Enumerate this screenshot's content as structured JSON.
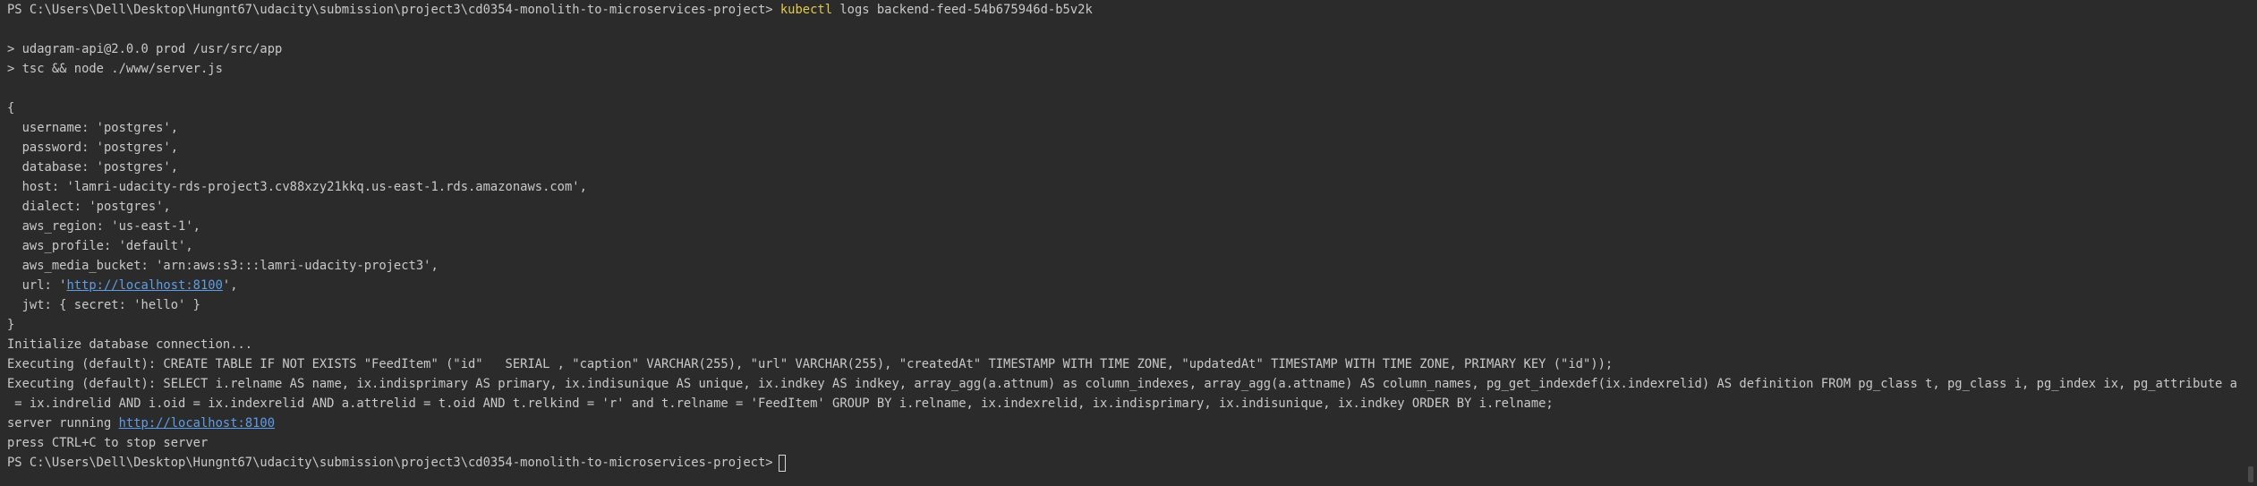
{
  "terminal": {
    "prompt1": "PS C:\\Users\\Dell\\Desktop\\Hungnt67\\udacity\\submission\\project3\\cd0354-monolith-to-microservices-project>",
    "cmd_word": "kubectl",
    "cmd_rest": "logs backend-feed-54b675946d-b5v2k",
    "npm1": "> udagram-api@2.0.0 prod /usr/src/app",
    "npm2": "> tsc && node ./www/server.js",
    "brace_open": "{",
    "cfg_username": "  username: 'postgres',",
    "cfg_password": "  password: 'postgres',",
    "cfg_database": "  database: 'postgres',",
    "cfg_host": "  host: 'lamri-udacity-rds-project3.cv88xzy21kkq.us-east-1.rds.amazonaws.com',",
    "cfg_dialect": "  dialect: 'postgres',",
    "cfg_region": "  aws_region: 'us-east-1',",
    "cfg_profile": "  aws_profile: 'default',",
    "cfg_bucket": "  aws_media_bucket: 'arn:aws:s3:::lamri-udacity-project3',",
    "cfg_url_prefix": "  url: '",
    "cfg_url_link": "http://localhost:8100",
    "cfg_url_suffix": "',",
    "cfg_jwt": "  jwt: { secret: 'hello' }",
    "brace_close": "}",
    "init": "Initialize database connection...",
    "exec1": "Executing (default): CREATE TABLE IF NOT EXISTS \"FeedItem\" (\"id\"   SERIAL , \"caption\" VARCHAR(255), \"url\" VARCHAR(255), \"createdAt\" TIMESTAMP WITH TIME ZONE, \"updatedAt\" TIMESTAMP WITH TIME ZONE, PRIMARY KEY (\"id\"));",
    "exec2a": "Executing (default): SELECT i.relname AS name, ix.indisprimary AS primary, ix.indisunique AS unique, ix.indkey AS indkey, array_agg(a.attnum) as column_indexes, array_agg(a.attname) AS column_names, pg_get_indexdef(ix.indexrelid) AS definition FROM pg_class t, pg_class i, pg_index ix, pg_attribute a WHERE t.oid",
    "exec2b": " = ix.indrelid AND i.oid = ix.indexrelid AND a.attrelid = t.oid AND t.relkind = 'r' and t.relname = 'FeedItem' GROUP BY i.relname, ix.indexrelid, ix.indisprimary, ix.indisunique, ix.indkey ORDER BY i.relname;",
    "server_prefix": "server running ",
    "server_link": "http://localhost:8100",
    "stop": "press CTRL+C to stop server",
    "prompt2": "PS C:\\Users\\Dell\\Desktop\\Hungnt67\\udacity\\submission\\project3\\cd0354-monolith-to-microservices-project>"
  }
}
